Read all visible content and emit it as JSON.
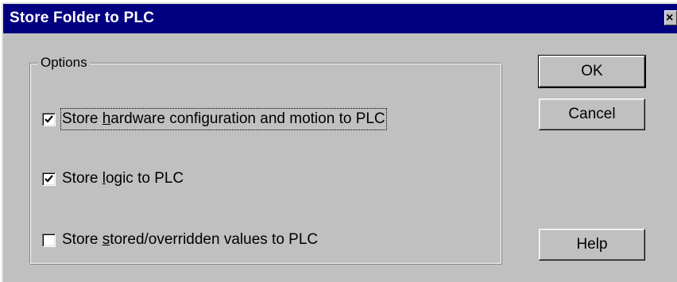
{
  "window": {
    "title": "Store Folder to PLC",
    "close_glyph": "×"
  },
  "options_group": {
    "legend": "Options",
    "items": [
      {
        "label_pre": "Store ",
        "label_accel": "h",
        "label_post": "ardware configuration and motion to PLC",
        "checked": true
      },
      {
        "label_pre": "Store ",
        "label_accel": "l",
        "label_post": "ogic to PLC",
        "checked": true
      },
      {
        "label_pre": "Store ",
        "label_accel": "s",
        "label_post": "tored/overridden values to PLC",
        "checked": false
      }
    ]
  },
  "buttons": {
    "ok": "OK",
    "cancel": "Cancel",
    "help": "Help"
  },
  "colors": {
    "titlebar": "#000080",
    "face": "#c0c0c0"
  }
}
